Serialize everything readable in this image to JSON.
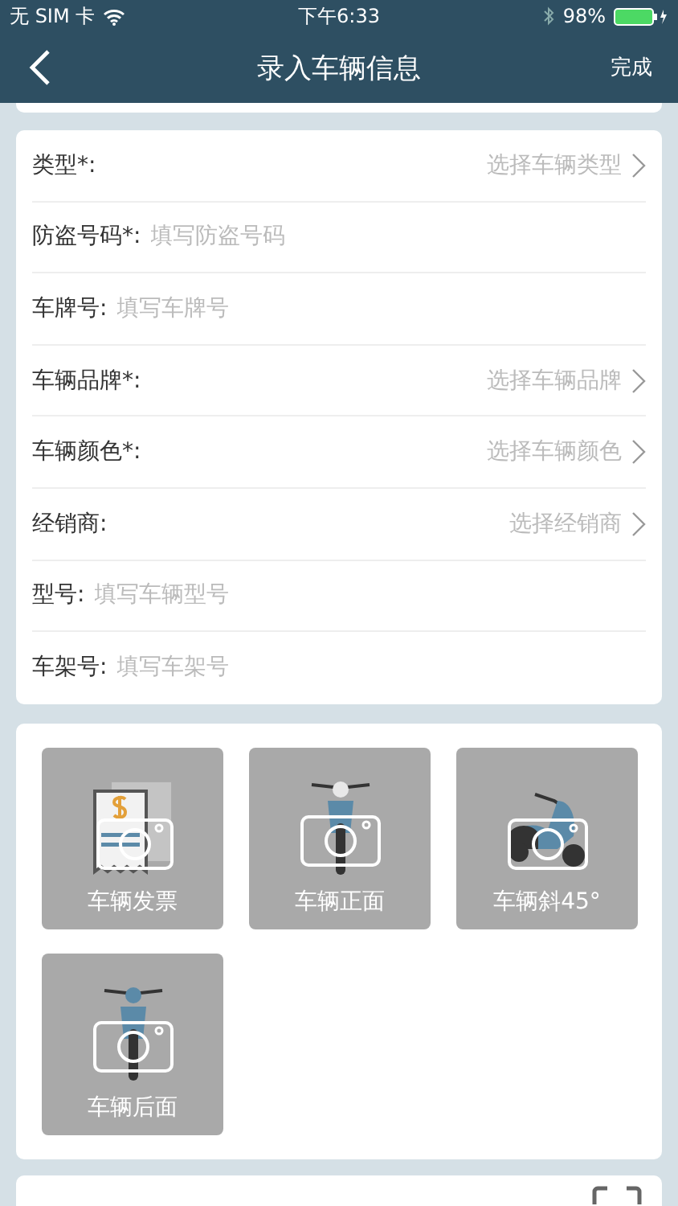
{
  "status_bar": {
    "carrier": "无 SIM 卡",
    "time": "下午6:33",
    "battery": "98%"
  },
  "nav": {
    "title": "录入车辆信息",
    "action": "完成"
  },
  "fields": [
    {
      "kind": "select",
      "label": "类型*:",
      "placeholder": "选择车辆类型"
    },
    {
      "kind": "input",
      "label": "防盗号码*:",
      "placeholder": "填写防盗号码"
    },
    {
      "kind": "input",
      "label": "车牌号:",
      "placeholder": "填写车牌号"
    },
    {
      "kind": "select",
      "label": "车辆品牌*:",
      "placeholder": "选择车辆品牌"
    },
    {
      "kind": "select",
      "label": "车辆颜色*:",
      "placeholder": "选择车辆颜色"
    },
    {
      "kind": "select",
      "label": "经销商:",
      "placeholder": "选择经销商"
    },
    {
      "kind": "input",
      "label": "型号:",
      "placeholder": "填写车辆型号"
    },
    {
      "kind": "input",
      "label": "车架号:",
      "placeholder": "填写车架号"
    }
  ],
  "photos": [
    {
      "kind": "invoice",
      "label": "车辆发票"
    },
    {
      "kind": "front",
      "label": "车辆正面"
    },
    {
      "kind": "angle",
      "label": "车辆斜45°"
    },
    {
      "kind": "rear",
      "label": "车辆后面"
    }
  ]
}
